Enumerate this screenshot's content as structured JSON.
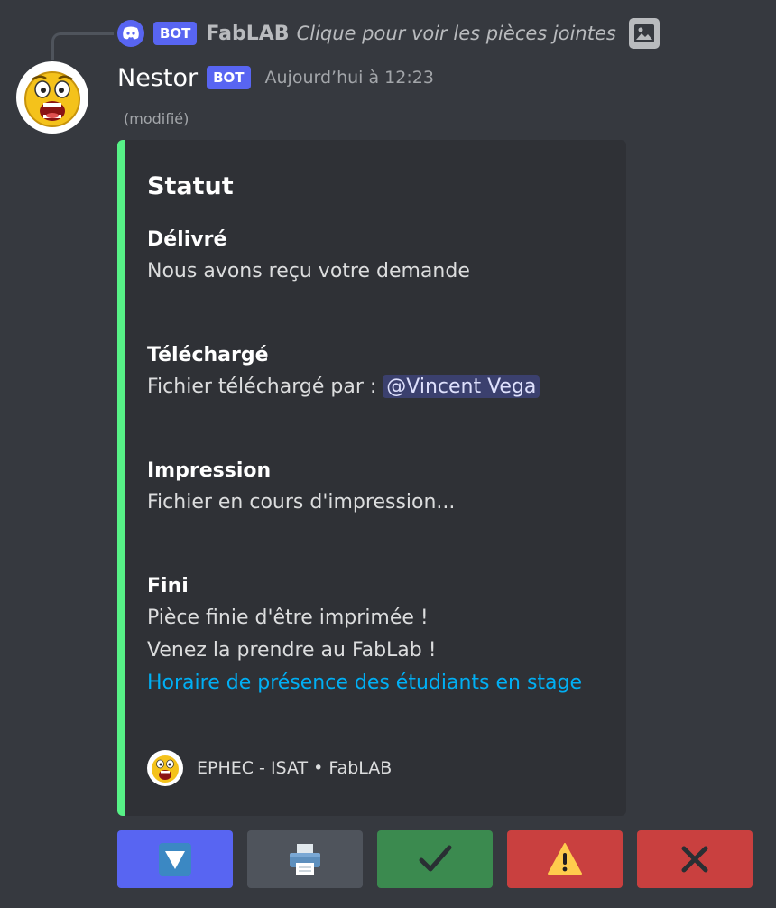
{
  "reply": {
    "bot_tag": "BOT",
    "author": "FabLAB",
    "text": "Clique pour voir les pièces jointes"
  },
  "message": {
    "author": "Nestor",
    "bot_tag": "BOT",
    "timestamp": "Aujourd’hui à 12:23",
    "edited": "(modifié)"
  },
  "embed": {
    "accent_color": "#57f287",
    "title": "Statut",
    "fields": [
      {
        "name": "Délivré",
        "value": "Nous avons reçu votre demande"
      },
      {
        "name": "Téléchargé",
        "value_prefix": "Fichier téléchargé par : ",
        "mention": "@Vincent Vega"
      },
      {
        "name": "Impression",
        "value": "Fichier en cours d'impression..."
      },
      {
        "name": "Fini",
        "lines": [
          "Pièce finie d'être imprimée !",
          "Venez la prendre au FabLab !"
        ],
        "link": "Horaire de présence des étudiants en stage"
      }
    ],
    "footer": "EPHEC - ISAT • FabLAB"
  },
  "buttons": [
    {
      "icon": "down-arrow-icon",
      "color": "#5865f2"
    },
    {
      "icon": "printer-icon",
      "color": "#4f545c"
    },
    {
      "icon": "checkmark-icon",
      "color": "#3b8a4f"
    },
    {
      "icon": "warning-icon",
      "color": "#c9403f"
    },
    {
      "icon": "cross-icon",
      "color": "#c9403f"
    }
  ]
}
